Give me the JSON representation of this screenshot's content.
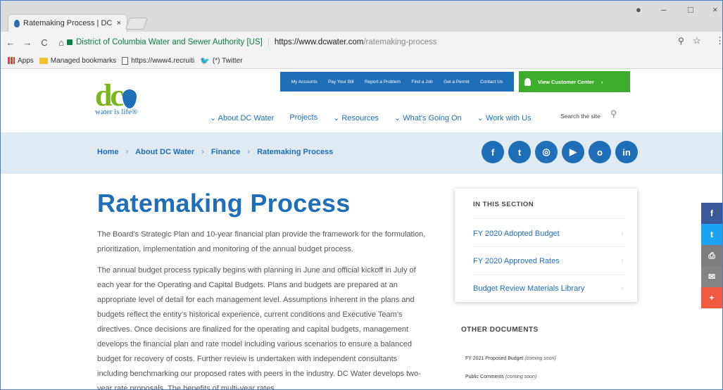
{
  "browser": {
    "tab_title": "Ratemaking Process | DC",
    "tab_close": "×",
    "window_controls": {
      "account": "●",
      "minimize": "–",
      "maximize": "□",
      "close": "×"
    },
    "nav": {
      "back": "←",
      "forward": "→",
      "reload": "C",
      "home": "⌂"
    },
    "address": {
      "org": "District of Columbia Water and Sewer Authority [US]",
      "separator": "|",
      "host": "https://www.dcwater.com",
      "path": "/ratemaking-process"
    },
    "toolbar_icons": {
      "zoom": "⚲",
      "star": "☆",
      "menu": "⋮"
    },
    "bookmarks": [
      {
        "label": "Apps",
        "icon": "apps-icon"
      },
      {
        "label": "Managed bookmarks",
        "icon": "folder-icon"
      },
      {
        "label": "https://www4.recruiti",
        "icon": "page-icon"
      },
      {
        "label": "(*) Twitter",
        "icon": "twitter-icon"
      }
    ]
  },
  "site": {
    "logo": {
      "mark": "dc",
      "tagline": "water is life®"
    },
    "utility_nav": [
      "My Accounts",
      "Pay Your Bill",
      "Report a Problem",
      "Find a Job",
      "Get a Permit",
      "Contact Us"
    ],
    "customer_center": "View Customer Center",
    "main_nav": [
      "About DC Water",
      "Projects",
      "Resources",
      "What's Going On",
      "Work with Us"
    ],
    "search_label": "Search the site",
    "breadcrumbs": [
      "Home",
      "About DC Water",
      "Finance",
      "Ratemaking Process"
    ],
    "breadcrumb_sep": "›",
    "social": [
      {
        "icon": "facebook-icon",
        "glyph": "f"
      },
      {
        "icon": "twitter-icon",
        "glyph": "t"
      },
      {
        "icon": "instagram-icon",
        "glyph": "◎"
      },
      {
        "icon": "youtube-icon",
        "glyph": "▶"
      },
      {
        "icon": "nextdoor-icon",
        "glyph": "o"
      },
      {
        "icon": "linkedin-icon",
        "glyph": "in"
      }
    ],
    "share_bar": [
      {
        "icon": "facebook-icon",
        "glyph": "f",
        "color": "#3b5998"
      },
      {
        "icon": "twitter-icon",
        "glyph": "t",
        "color": "#1da1f2"
      },
      {
        "icon": "print-icon",
        "glyph": "⎙",
        "color": "#7d7d7d"
      },
      {
        "icon": "email-icon",
        "glyph": "✉",
        "color": "#848484"
      },
      {
        "icon": "plus-icon",
        "glyph": "+",
        "color": "#f05a3f"
      }
    ]
  },
  "article": {
    "heading": "Ratemaking Process",
    "paragraphs": [
      "The Board’s Strategic Plan and 10-year financial plan provide the framework for the formulation, prioritization, implementation and monitoring of the annual budget process.",
      "The annual budget process typically begins with planning in June and official kickoff in July of each year for the Operating and Capital Budgets. Plans and budgets are prepared at an appropriate level of detail for each management level. Assumptions inherent in the plans and budgets reflect the entity’s historical experience, current conditions and Executive Team’s directives. Once decisions are finalized for the operating and capital budgets, management develops the financial plan and rate model including various scenarios to ensure a balanced budget for recovery of costs. Further review is undertaken with independent consultants including benchmarking our proposed rates with peers in the industry. DC Water develops two-year rate proposals. The benefits of multi-year rates"
    ]
  },
  "sidebar": {
    "in_this_section": "IN THIS SECTION",
    "links": [
      "FY 2020 Adopted Budget",
      "FY 2020 Approved Rates",
      "Budget Review Materials Library"
    ],
    "chevron": "›",
    "other_documents": "OTHER DOCUMENTS",
    "docs": [
      {
        "label": "FY 2021 Proposed Budget",
        "note": "(coming soon)"
      },
      {
        "label": "Public Comments",
        "note": "(coming soon)"
      }
    ]
  },
  "colors": {
    "brand_blue": "#1f6fb8",
    "brand_green": "#7ab51d",
    "cta_green": "#3dae2b",
    "band": "#dfeaf2"
  }
}
